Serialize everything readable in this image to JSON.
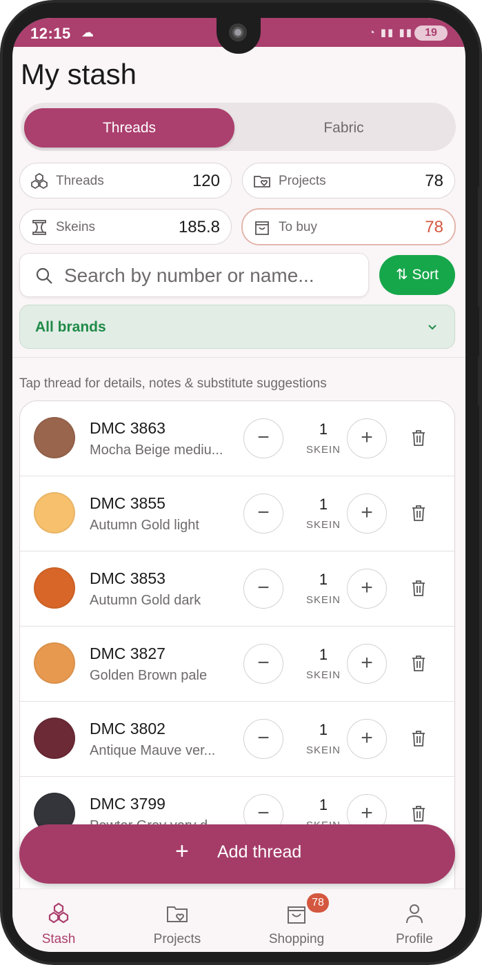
{
  "status_bar": {
    "time": "12:15",
    "battery": "19"
  },
  "header": {
    "title": "My stash"
  },
  "tabs": [
    {
      "label": "Threads",
      "active": true
    },
    {
      "label": "Fabric",
      "active": false
    }
  ],
  "stats": {
    "threads": {
      "label": "Threads",
      "value": "120"
    },
    "projects": {
      "label": "Projects",
      "value": "78"
    },
    "skeins": {
      "label": "Skeins",
      "value": "185.8"
    },
    "to_buy": {
      "label": "To buy",
      "value": "78"
    }
  },
  "search": {
    "placeholder": "Search by number or name..."
  },
  "sort_label": "Sort",
  "brand_filter": {
    "selected": "All brands"
  },
  "hint": "Tap thread for details, notes & substitute suggestions",
  "threads": [
    {
      "code": "DMC 3863",
      "name": "Mocha Beige mediu...",
      "qty": "1",
      "unit": "SKEIN",
      "color": "#99654d"
    },
    {
      "code": "DMC 3855",
      "name": "Autumn Gold light",
      "qty": "1",
      "unit": "SKEIN",
      "color": "#f7c06d"
    },
    {
      "code": "DMC 3853",
      "name": "Autumn Gold dark",
      "qty": "1",
      "unit": "SKEIN",
      "color": "#d76628"
    },
    {
      "code": "DMC 3827",
      "name": "Golden Brown pale",
      "qty": "1",
      "unit": "SKEIN",
      "color": "#e7994f"
    },
    {
      "code": "DMC 3802",
      "name": "Antique Mauve ver...",
      "qty": "1",
      "unit": "SKEIN",
      "color": "#6b2a36"
    },
    {
      "code": "DMC 3799",
      "name": "Pewter Grey very d...",
      "qty": "1",
      "unit": "SKEIN",
      "color": "#33353a"
    }
  ],
  "fab": {
    "label": "Add thread"
  },
  "nav": [
    {
      "label": "Stash",
      "active": true
    },
    {
      "label": "Projects",
      "active": false
    },
    {
      "label": "Shopping",
      "active": false,
      "badge": "78"
    },
    {
      "label": "Profile",
      "active": false
    }
  ],
  "colors": {
    "accent": "#ab3f6e",
    "green": "#17a74b",
    "warning": "#d4573f"
  }
}
